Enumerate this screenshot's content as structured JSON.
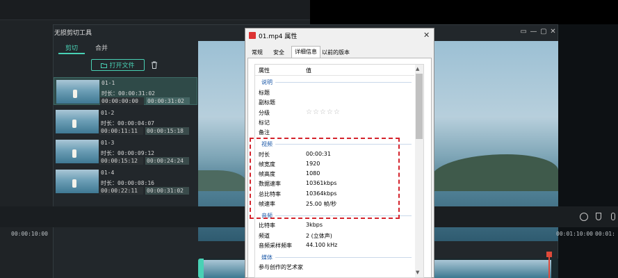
{
  "editor": {
    "title": "无损剪切工具",
    "window_controls": [
      "▭",
      "—",
      "▢",
      "✕"
    ],
    "tabs": [
      {
        "label": "剪切",
        "active": true
      },
      {
        "label": "合并",
        "active": false
      }
    ],
    "open_file_label": "打开文件",
    "clips": [
      {
        "name": "01-1",
        "duration": "时长：00:00:31:02",
        "start": "00:00:00:00",
        "end": "00:00:31:02",
        "active": true
      },
      {
        "name": "01-2",
        "duration": "时长：00:00:04:07",
        "start": "00:00:11:11",
        "end": "00:00:15:18",
        "active": false
      },
      {
        "name": "01-3",
        "duration": "时长：00:00:09:12",
        "start": "00:00:15:12",
        "end": "00:00:24:24",
        "active": false
      },
      {
        "name": "01-4",
        "duration": "时长：00:00:08:16",
        "start": "00:00:22:11",
        "end": "00:00:31:02",
        "active": false
      }
    ],
    "timeline": {
      "time_left": "00:00:10:00",
      "time_right_1": "00:01:10:00",
      "time_right_2": "00:01:"
    }
  },
  "dialog": {
    "title": "01.mp4 属性",
    "tabs": [
      "常规",
      "安全",
      "详细信息",
      "以前的版本"
    ],
    "selected_tab": "详细信息",
    "columns": {
      "property": "属性",
      "value": "值"
    },
    "sections": {
      "description": {
        "heading": "说明",
        "rows": [
          {
            "label": "标题",
            "value": ""
          },
          {
            "label": "副标题",
            "value": ""
          },
          {
            "label": "分级",
            "value": "☆☆☆☆☆"
          },
          {
            "label": "标记",
            "value": ""
          },
          {
            "label": "备注",
            "value": ""
          }
        ]
      },
      "video": {
        "heading": "视频",
        "rows": [
          {
            "label": "时长",
            "value": "00:00:31"
          },
          {
            "label": "帧宽度",
            "value": "1920"
          },
          {
            "label": "帧高度",
            "value": "1080"
          },
          {
            "label": "数据速率",
            "value": "10361kbps"
          },
          {
            "label": "总比特率",
            "value": "10364kbps"
          },
          {
            "label": "帧速率",
            "value": "25.00 帧/秒"
          }
        ]
      },
      "audio": {
        "heading": "音频",
        "rows": [
          {
            "label": "比特率",
            "value": "3kbps"
          },
          {
            "label": "频道",
            "value": "2 (立体声)"
          },
          {
            "label": "音频采样频率",
            "value": "44.100 kHz"
          }
        ]
      },
      "media": {
        "heading": "媒体",
        "rows": [
          {
            "label": "参与创作的艺术家",
            "value": ""
          }
        ]
      }
    }
  },
  "colors": {
    "accent": "#49d1b5",
    "highlight": "#d4232c",
    "section_heading": "#1e5aa8"
  }
}
